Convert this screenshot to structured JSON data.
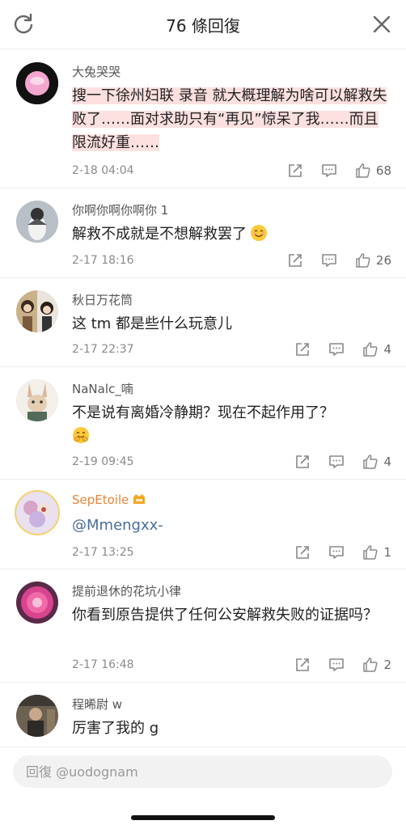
{
  "header": {
    "title": "76 條回復"
  },
  "comments": [
    {
      "username": "大兔哭哭",
      "content_highlighted": "搜一下徐州妇联 录音 就大概理解为啥可以解救失败了……面对求助只有“再见”惊呆了我……而且限流好重……",
      "date": "2-18 04:04",
      "likes": "68"
    },
    {
      "username": "你啊你啊你啊你 1",
      "content": "解救不成就是不想解救罢了",
      "date": "2-17 18:16",
      "likes": "26"
    },
    {
      "username": "秋日万花筒",
      "content": "这 tm 都是些什么玩意儿",
      "date": "2-17 22:37",
      "likes": "4"
    },
    {
      "username": "NaNalc_喃",
      "content": "不是说有离婚冷静期？现在不起作用了？",
      "date": "2-19 09:45",
      "likes": "4"
    },
    {
      "username": "SepEtoile",
      "content": "@Mmengxx-",
      "date": "2-17 13:25",
      "likes": "1"
    },
    {
      "username": "提前退休的花坑小律",
      "content": "你看到原告提供了任何公安解救失败的证据吗？",
      "date": "2-17 16:48",
      "likes": "2"
    },
    {
      "username": "程晞尉 w",
      "content": "厉害了我的 g"
    }
  ],
  "reply": {
    "placeholder": "回復 @uodognam"
  },
  "colors": {
    "highlight": "#fde0e0",
    "vip_name": "#e8843a",
    "mention": "#4a6d9a"
  },
  "icons": [
    "refresh-icon",
    "close-icon",
    "share-icon",
    "comment-icon",
    "thumbs-up-icon"
  ]
}
